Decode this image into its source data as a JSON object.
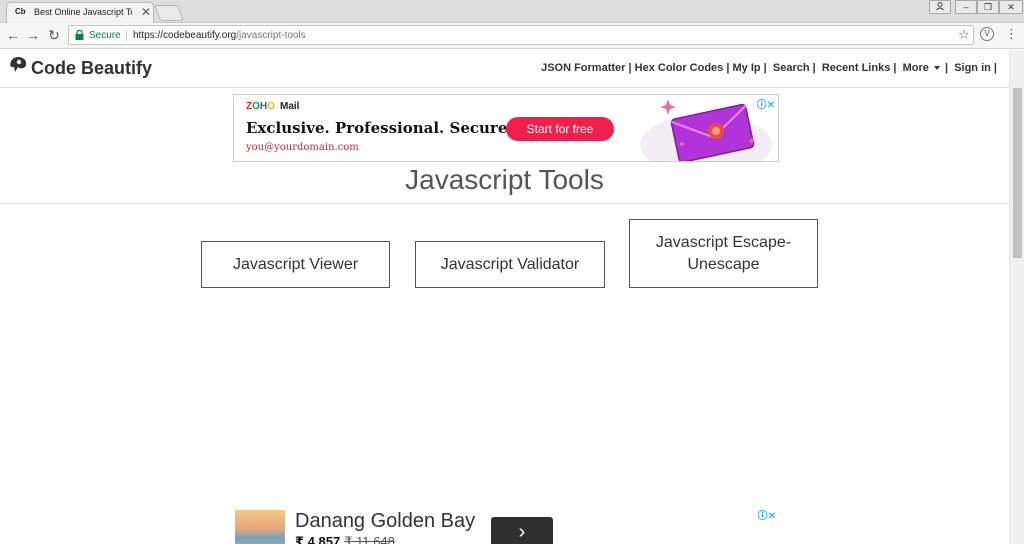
{
  "browser": {
    "tab": {
      "favicon_text": "Cb",
      "title": "Best Online Javascript To",
      "close": "✕"
    },
    "nav": {
      "back": "←",
      "forward": "→",
      "reload": "↻"
    },
    "omnibox": {
      "secure_label": "Secure",
      "url_host": "https://codebeautify.org",
      "url_path": "/javascript-tools"
    },
    "star": "☆",
    "extension": "V",
    "menu": "⋮"
  },
  "site": {
    "logo_text": "Code Beautify",
    "nav": [
      "JSON Formatter",
      "Hex Color Codes",
      "My Ip",
      "Search",
      "Recent Links",
      "More",
      "Sign in"
    ],
    "separator": "|"
  },
  "ad_top": {
    "brand": {
      "z": "Z",
      "o1": "O",
      "h": "H",
      "o2": "O"
    },
    "product": "Mail",
    "headline": "Exclusive. Professional. Secure.",
    "email": "you@yourdomain.com",
    "cta": "Start for free",
    "adchoices": "ⓘ✕"
  },
  "page": {
    "title": "Javascript Tools",
    "tools": [
      {
        "label": "Javascript Viewer"
      },
      {
        "label": "Javascript Validator"
      },
      {
        "label": "Javascript Escape-\nUnescape"
      }
    ]
  },
  "ad_bottom": {
    "name": "Danang Golden Bay",
    "price": "₹ 4,857",
    "old_price": "₹ 11,648",
    "arrow": "›",
    "adchoices": "ⓘ✕"
  },
  "colors": {
    "secure_green": "#0b8043",
    "cta_red": "#f01f4b",
    "adchoices_blue": "#00aecd"
  }
}
